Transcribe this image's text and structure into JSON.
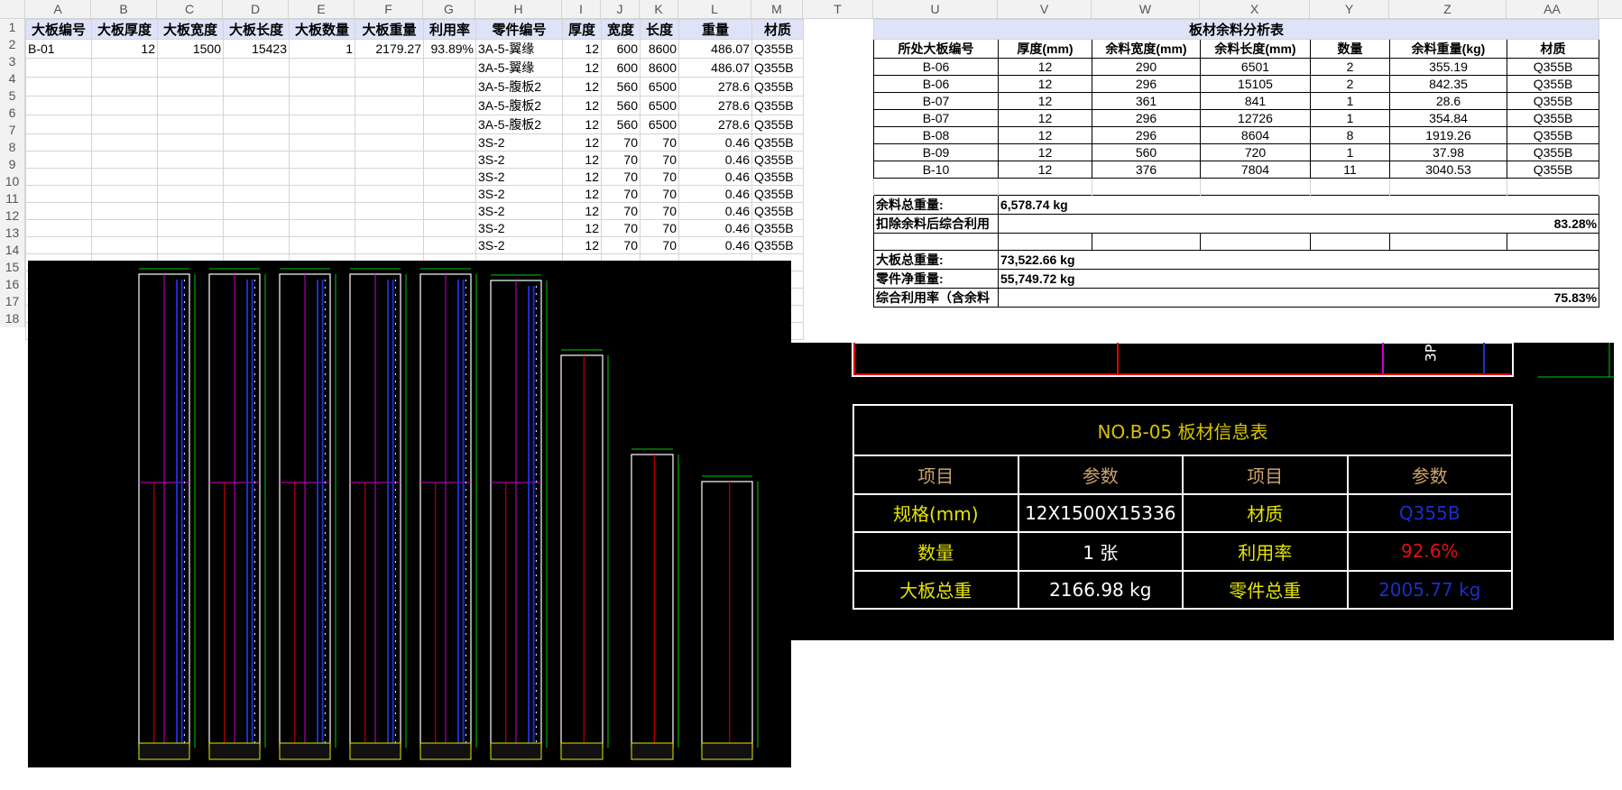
{
  "columns_left": [
    "A",
    "B",
    "C",
    "D",
    "E",
    "F",
    "G",
    "H",
    "I",
    "J",
    "K",
    "L",
    "M"
  ],
  "columns_right": [
    "T",
    "U",
    "V",
    "W",
    "X",
    "Y",
    "Z",
    "AA"
  ],
  "rows": [
    "1",
    "2",
    "3",
    "4",
    "5",
    "6",
    "7",
    "8",
    "9",
    "10",
    "11",
    "12",
    "13",
    "14",
    "15",
    "16",
    "17",
    "18"
  ],
  "main_table": {
    "headers": [
      "大板编号",
      "大板厚度",
      "大板宽度",
      "大板长度",
      "大板数量",
      "大板重量",
      "利用率",
      "零件编号",
      "厚度",
      "宽度",
      "长度",
      "重量",
      "材质"
    ],
    "rows": [
      [
        "B-01",
        "12",
        "1500",
        "15423",
        "1",
        "2179.27",
        "93.89%",
        "3A-5-翼缘",
        "12",
        "600",
        "8600",
        "486.07",
        "Q355B"
      ],
      [
        "",
        "",
        "",
        "",
        "",
        "",
        "",
        "3A-5-翼缘",
        "12",
        "600",
        "8600",
        "486.07",
        "Q355B"
      ],
      [
        "",
        "",
        "",
        "",
        "",
        "",
        "",
        "3A-5-腹板2",
        "12",
        "560",
        "6500",
        "278.6",
        "Q355B"
      ],
      [
        "",
        "",
        "",
        "",
        "",
        "",
        "",
        "3A-5-腹板2",
        "12",
        "560",
        "6500",
        "278.6",
        "Q355B"
      ],
      [
        "",
        "",
        "",
        "",
        "",
        "",
        "",
        "3A-5-腹板2",
        "12",
        "560",
        "6500",
        "278.6",
        "Q355B"
      ],
      [
        "",
        "",
        "",
        "",
        "",
        "",
        "",
        "3S-2",
        "12",
        "70",
        "70",
        "0.46",
        "Q355B"
      ],
      [
        "",
        "",
        "",
        "",
        "",
        "",
        "",
        "3S-2",
        "12",
        "70",
        "70",
        "0.46",
        "Q355B"
      ],
      [
        "",
        "",
        "",
        "",
        "",
        "",
        "",
        "3S-2",
        "12",
        "70",
        "70",
        "0.46",
        "Q355B"
      ],
      [
        "",
        "",
        "",
        "",
        "",
        "",
        "",
        "3S-2",
        "12",
        "70",
        "70",
        "0.46",
        "Q355B"
      ],
      [
        "",
        "",
        "",
        "",
        "",
        "",
        "",
        "3S-2",
        "12",
        "70",
        "70",
        "0.46",
        "Q355B"
      ],
      [
        "",
        "",
        "",
        "",
        "",
        "",
        "",
        "3S-2",
        "12",
        "70",
        "70",
        "0.46",
        "Q355B"
      ],
      [
        "",
        "",
        "",
        "",
        "",
        "",
        "",
        "3S-2",
        "12",
        "70",
        "70",
        "0.46",
        "Q355B"
      ]
    ]
  },
  "analysis": {
    "title": "板材余料分析表",
    "headers": [
      "所处大板编号",
      "厚度(mm)",
      "余料宽度(mm)",
      "余料长度(mm)",
      "数量",
      "余料重量(kg)",
      "材质"
    ],
    "rows": [
      [
        "B-06",
        "12",
        "290",
        "6501",
        "2",
        "355.19",
        "Q355B"
      ],
      [
        "B-06",
        "12",
        "296",
        "15105",
        "2",
        "842.35",
        "Q355B"
      ],
      [
        "B-07",
        "12",
        "361",
        "841",
        "1",
        "28.6",
        "Q355B"
      ],
      [
        "B-07",
        "12",
        "296",
        "12726",
        "1",
        "354.84",
        "Q355B"
      ],
      [
        "B-08",
        "12",
        "296",
        "8604",
        "8",
        "1919.26",
        "Q355B"
      ],
      [
        "B-09",
        "12",
        "560",
        "720",
        "1",
        "37.98",
        "Q355B"
      ],
      [
        "B-10",
        "12",
        "376",
        "7804",
        "11",
        "3040.53",
        "Q355B"
      ]
    ],
    "remain_total_label": "余料总重量:",
    "remain_total_value": "6,578.74 kg",
    "util_after_label": "扣除余料后综合利用",
    "util_after_value": "83.28%",
    "plate_total_label": "大板总重量:",
    "plate_total_value": "73,522.66 kg",
    "part_net_label": "零件净重量:",
    "part_net_value": "55,749.72 kg",
    "util_total_label": "综合利用率（含余料",
    "util_total_value": "75.83%"
  },
  "cad_info": {
    "title": "NO.B-05   板材信息表",
    "h_item1": "项目",
    "h_param1": "参数",
    "h_item2": "项目",
    "h_param2": "参数",
    "spec_label": "规格(mm)",
    "spec_value": "12X1500X15336",
    "material_label": "材质",
    "material_value": "Q355B",
    "qty_label": "数量",
    "qty_value": "1 张",
    "util_label": "利用率",
    "util_value": "92.6%",
    "plate_weight_label": "大板总重",
    "plate_weight_value": "2166.98 kg",
    "part_weight_label": "零件总重",
    "part_weight_value": "2005.77 kg",
    "partial_label": "3P",
    "colors": {
      "material": "#1a2fc8",
      "util": "#e01010",
      "part_weight": "#1a2fc8"
    }
  }
}
